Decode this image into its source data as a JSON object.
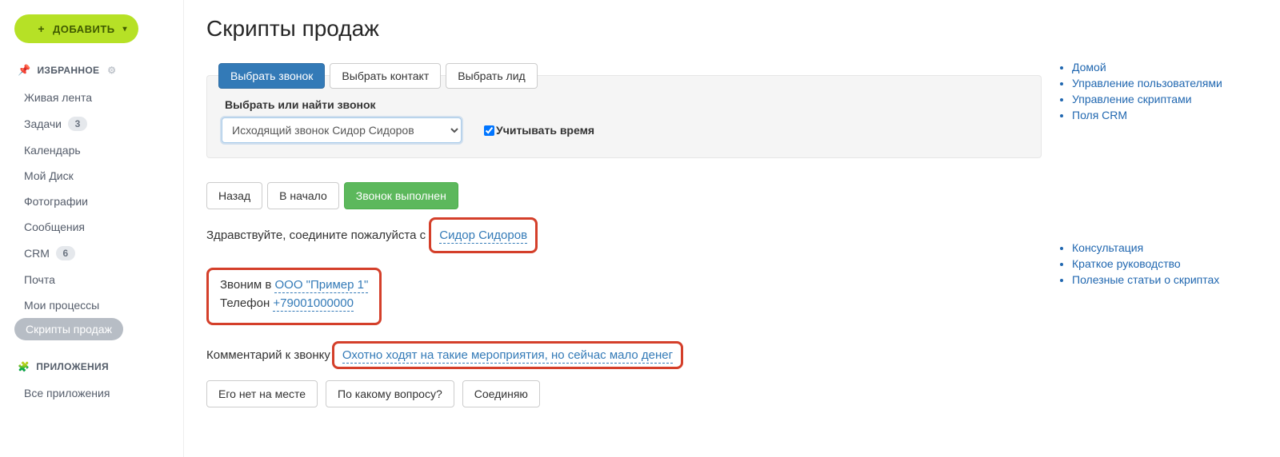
{
  "sidebar": {
    "add_label": "ДОБАВИТЬ",
    "favorites_header": "ИЗБРАННОЕ",
    "apps_header": "ПРИЛОЖЕНИЯ",
    "items": [
      {
        "label": "Живая лента",
        "badge": null
      },
      {
        "label": "Задачи",
        "badge": "3"
      },
      {
        "label": "Календарь",
        "badge": null
      },
      {
        "label": "Мой Диск",
        "badge": null
      },
      {
        "label": "Фотографии",
        "badge": null
      },
      {
        "label": "Сообщения",
        "badge": null
      },
      {
        "label": "CRM",
        "badge": "6"
      },
      {
        "label": "Почта",
        "badge": null
      },
      {
        "label": "Мои процессы",
        "badge": null
      },
      {
        "label": "Скрипты продаж",
        "badge": null
      }
    ],
    "all_apps": "Все приложения"
  },
  "page": {
    "title": "Скрипты продаж"
  },
  "tabs": {
    "call": "Выбрать звонок",
    "contact": "Выбрать контакт",
    "lead": "Выбрать лид"
  },
  "well": {
    "label": "Выбрать или найти звонок",
    "selected": "Исходящий звонок Сидор Сидоров",
    "time_label": "Учитывать время"
  },
  "actions": {
    "back": "Назад",
    "start": "В начало",
    "done": "Звонок выполнен"
  },
  "script": {
    "greeting_prefix": "Здравствуйте, соедините пожалуйста с ",
    "contact_name": "Сидор Сидоров",
    "call_to_prefix": "Звоним в ",
    "company": "ООО \"Пример 1\"",
    "phone_prefix": "Телефон ",
    "phone": "+79001000000",
    "comment_prefix": "Комментарий к звонку ",
    "comment_text": "Охотно ходят на такие мероприятия, но сейчас мало денег",
    "options": {
      "not_here": "Его нет на месте",
      "what_about": "По какому вопросу?",
      "connecting": "Соединяю"
    }
  },
  "right": {
    "group1": [
      "Домой",
      "Управление пользователями",
      "Управление скриптами",
      "Поля CRM"
    ],
    "group2": [
      "Консультация",
      "Краткое руководство",
      "Полезные статьи о скриптах"
    ]
  }
}
